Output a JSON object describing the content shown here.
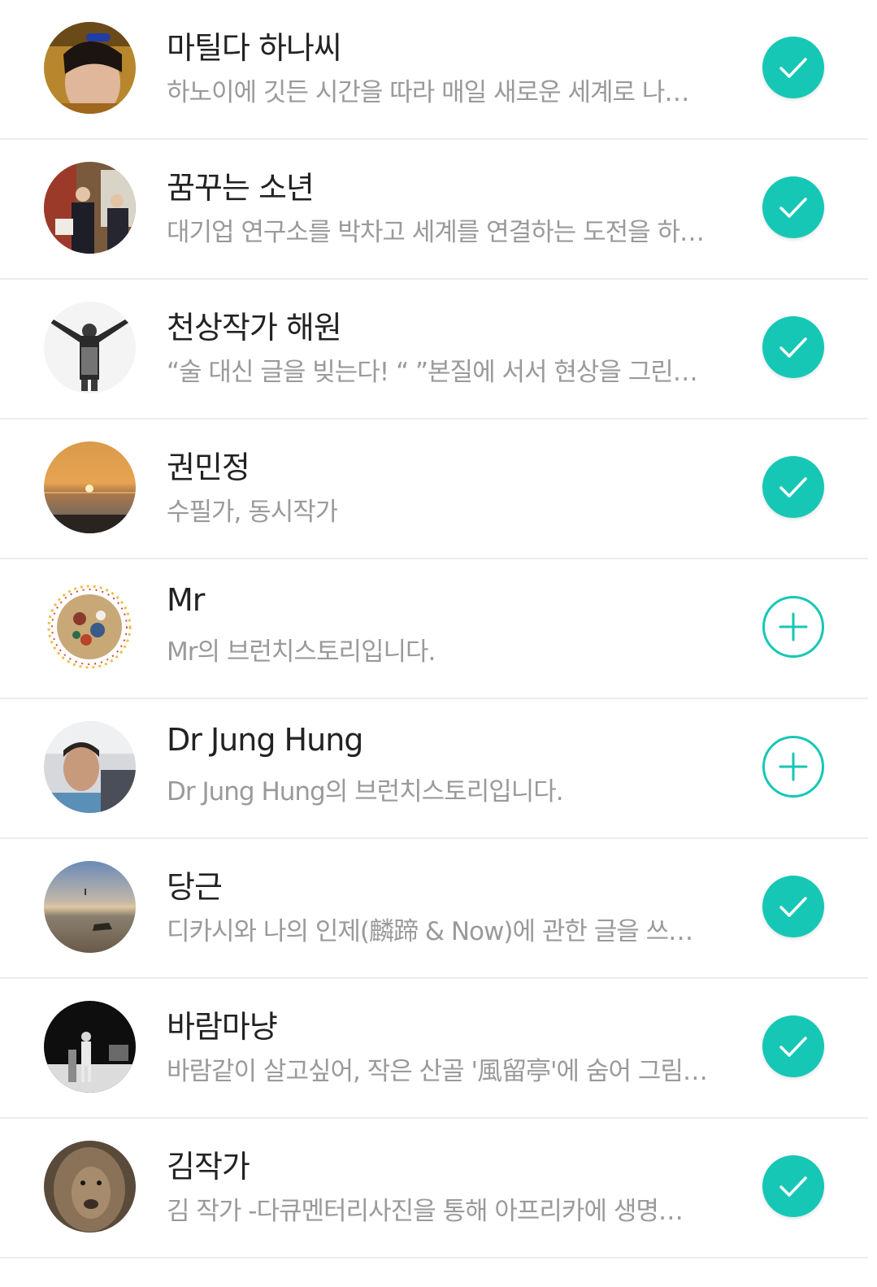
{
  "rows": [
    {
      "name": "마틸다 하나씨",
      "desc": "하노이에 깃든 시간을 따라 매일 새로운 세계로 나…",
      "followed": true
    },
    {
      "name": "꿈꾸는 소년",
      "desc": "대기업 연구소를 박차고 세계를 연결하는 도전을 하…",
      "followed": true
    },
    {
      "name": "천상작가 해원",
      "desc": "“술 대신 글을 빚는다! “ ”본질에 서서 현상을 그린…",
      "followed": true
    },
    {
      "name": "권민정",
      "desc": "수필가, 동시작가",
      "followed": true
    },
    {
      "name": "Mr",
      "desc": "Mr의 브런치스토리입니다.",
      "followed": false
    },
    {
      "name": "Dr Jung Hung",
      "desc": "Dr Jung Hung의 브런치스토리입니다.",
      "followed": false
    },
    {
      "name": "당근",
      "desc": "디카시와 나의 인제(麟蹄 & Now)에 관한 글을 쓰…",
      "followed": true
    },
    {
      "name": "바람마냥",
      "desc": "바람같이 살고싶어, 작은 산골 '風留亭'에 숨어 그림…",
      "followed": true
    },
    {
      "name": "김작가",
      "desc": "김 작가 -다큐멘터리사진을 통해 아프리카에 생명…",
      "followed": true
    }
  ],
  "colors": {
    "accent": "#16c7b5",
    "name_text": "#222222",
    "desc_text": "#9a9a9a",
    "divider": "#ececec"
  },
  "icons": {
    "followed": "check-icon",
    "not_followed": "plus-icon"
  }
}
